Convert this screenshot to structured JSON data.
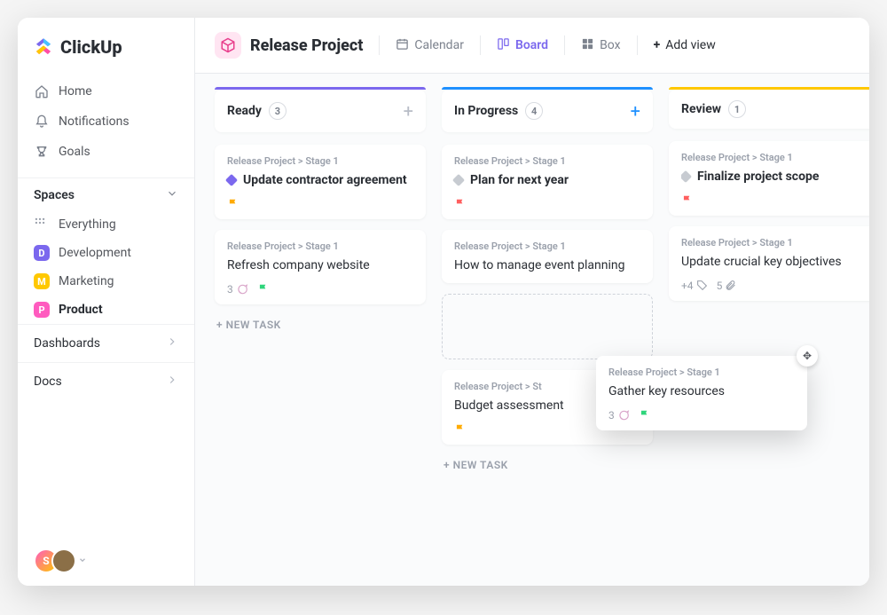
{
  "brand": "ClickUp",
  "nav": {
    "home": "Home",
    "notifications": "Notifications",
    "goals": "Goals"
  },
  "spaces": {
    "header": "Spaces",
    "everything": "Everything",
    "items": [
      {
        "letter": "D",
        "label": "Development",
        "color": "#7b68ee"
      },
      {
        "letter": "M",
        "label": "Marketing",
        "color": "#ffc800"
      },
      {
        "letter": "P",
        "label": "Product",
        "color": "#ff5bbf"
      }
    ]
  },
  "sections": {
    "dashboards": "Dashboards",
    "docs": "Docs"
  },
  "avatars": {
    "letter": "S"
  },
  "header": {
    "project": "Release Project",
    "views": {
      "calendar": "Calendar",
      "board": "Board",
      "box": "Box",
      "add": "Add view"
    }
  },
  "board": {
    "new_task": "+ NEW TASK",
    "columns": [
      {
        "title": "Ready",
        "count": "3",
        "cards": [
          {
            "crumb": "Release Project > Stage 1",
            "title": "Update contractor agreement",
            "bold": true,
            "diamond": "#7b68ee",
            "flag": "#ffab00"
          },
          {
            "crumb": "Release Project > Stage 1",
            "title": "Refresh company website",
            "comments": "3",
            "flag": "#2fd57b"
          }
        ]
      },
      {
        "title": "In Progress",
        "count": "4",
        "cards": [
          {
            "crumb": "Release Project > Stage 1",
            "title": "Plan for next year",
            "bold": true,
            "diamond": "#c7cbd1",
            "flag": "#ff5f5f"
          },
          {
            "crumb": "Release Project > Stage 1",
            "title": "How to manage event planning"
          },
          {
            "crumb": "Release Project > St",
            "title": "Budget assessment",
            "flag": "#ffab00",
            "cutoff": true
          }
        ]
      },
      {
        "title": "Review",
        "count": "1",
        "cards": [
          {
            "crumb": "Release Project > Stage 1",
            "title": "Finalize project scope",
            "bold": true,
            "diamond": "#c7cbd1",
            "flag": "#ff5f5f"
          },
          {
            "crumb": "Release Project > Stage 1",
            "title": "Update crucial key objectives",
            "tags": "+4",
            "attach": "5"
          }
        ]
      }
    ],
    "dragging": {
      "crumb": "Release Project > Stage 1",
      "title": "Gather key resources",
      "comments": "3",
      "flag": "#2fd57b"
    }
  }
}
